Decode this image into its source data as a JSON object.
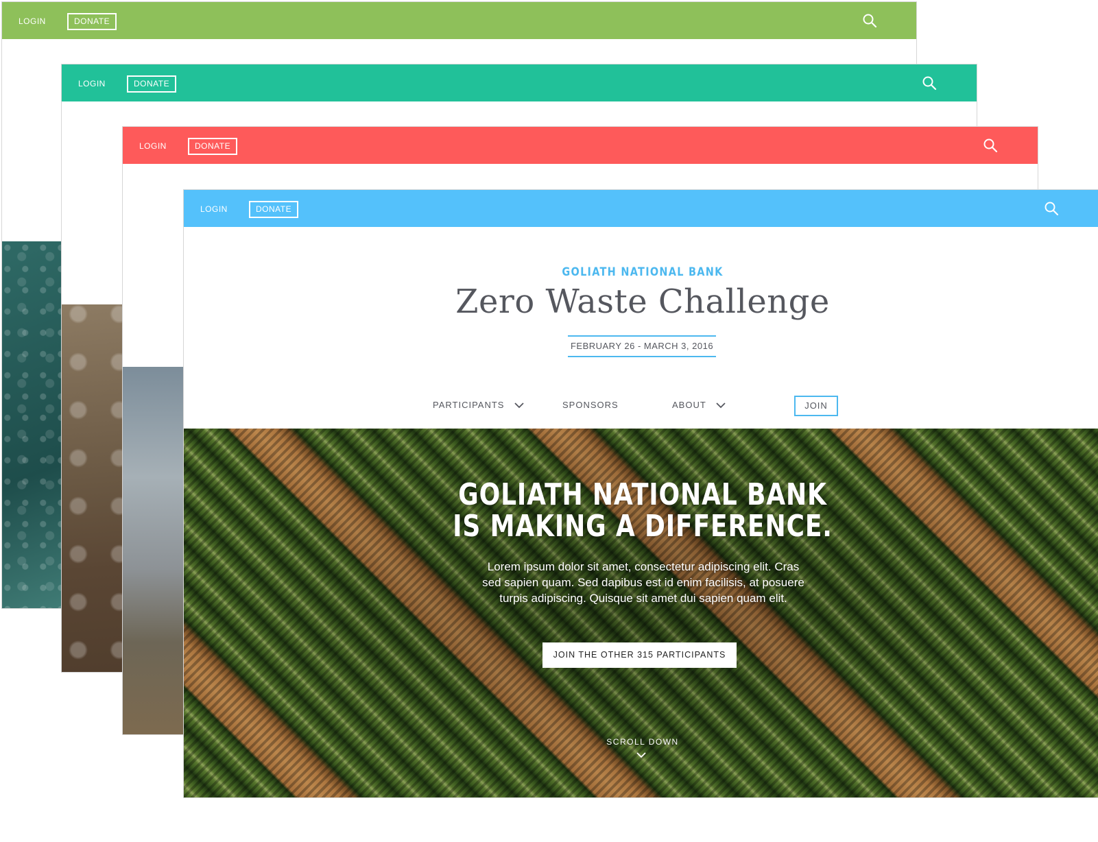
{
  "colors": {
    "window_1_bar": "#8ec05a",
    "window_2_bar": "#21c199",
    "window_3_bar": "#fe5a5a",
    "window_4_bar": "#54c1fb",
    "accent": "#4cb8ef",
    "text": "#55575e"
  },
  "window_1": {
    "login_label": "LOGIN",
    "donate_label": "DONATE",
    "search_icon": "search-icon"
  },
  "window_2": {
    "login_label": "LOGIN",
    "donate_label": "DONATE",
    "search_icon": "search-icon"
  },
  "window_3": {
    "login_label": "LOGIN",
    "donate_label": "DONATE",
    "search_icon": "search-icon"
  },
  "window_4": {
    "login_label": "LOGIN",
    "donate_label": "DONATE",
    "search_icon": "search-icon",
    "organization": "GOLIATH NATIONAL BANK",
    "title": "Zero Waste Challenge",
    "dates": "FEBRUARY 26  -  MARCH 3, 2016",
    "nav": {
      "participants_label": "PARTICIPANTS",
      "sponsors_label": "SPONSORS",
      "about_label": "ABOUT",
      "join_label": "JOIN"
    },
    "hero": {
      "headline_line1": "GOLIATH NATIONAL BANK",
      "headline_line2": "IS MAKING A DIFFERENCE.",
      "body": "Lorem ipsum dolor sit amet, consectetur adipiscing elit. Cras sed sapien quam. Sed dapibus est id enim facilisis, at posuere turpis adipiscing. Quisque sit amet dui sapien quam elit.",
      "cta_label": "JOIN THE OTHER 315 PARTICIPANTS",
      "scroll_label": "SCROLL DOWN"
    }
  }
}
